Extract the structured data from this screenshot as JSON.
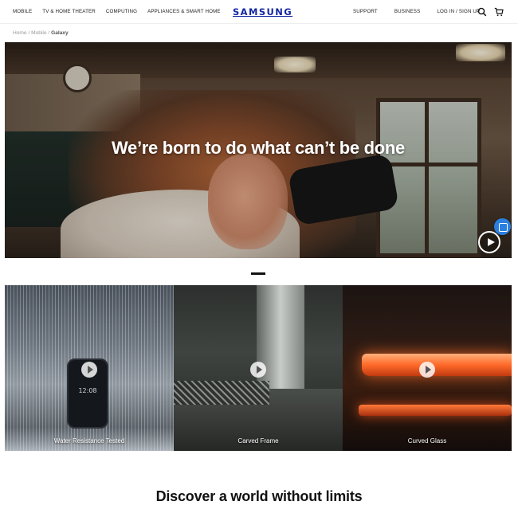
{
  "nav": {
    "left_items": [
      "MOBILE",
      "TV & HOME THEATER",
      "COMPUTING",
      "APPLIANCES & SMART HOME"
    ],
    "logo": "SAMSUNG",
    "right_items": [
      "SUPPORT",
      "BUSINESS",
      "LOG IN / SIGN UP"
    ],
    "icons": [
      "search-icon",
      "cart-icon"
    ]
  },
  "breadcrumb": {
    "items": [
      "Home",
      "Mobile"
    ],
    "separator": "/",
    "current": "Galaxy"
  },
  "hero": {
    "headline": "We’re born to do what can’t be done",
    "play_icon": "play-icon"
  },
  "tiles": [
    {
      "label": "Water Resistance Tested",
      "phone_time": "12:08"
    },
    {
      "label": "Carved Frame"
    },
    {
      "label": "Curved Glass"
    }
  ],
  "section": {
    "heading": "Discover a world without limits"
  },
  "colors": {
    "brand": "#1428a0",
    "widget": "#2a7fe0"
  }
}
